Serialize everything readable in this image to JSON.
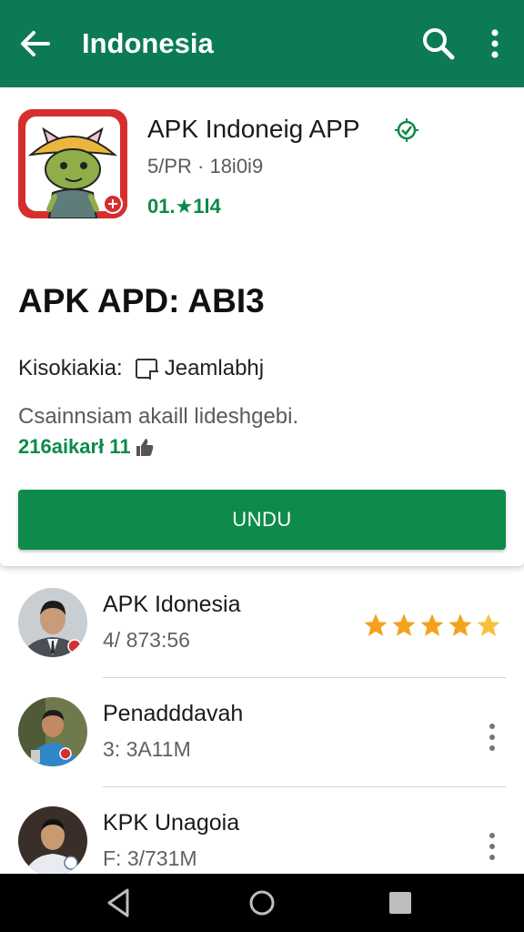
{
  "appbar": {
    "title": "Indonesia",
    "back_icon": "arrow-back-icon",
    "search_icon": "search-icon",
    "more_icon": "more-vert-icon",
    "color": "#0b7a55"
  },
  "app_card": {
    "name": "APK Indoneig APP",
    "developer": "5/PR · 18i0i9",
    "rating": "01.★1l4",
    "headline": "APK APD: ABI3",
    "meta_left": "Kisokiakia:",
    "meta_right": "Jeamlabhj",
    "description": "Csainnsiam akaill lideshgebi.",
    "downloads": "216aikarł 11",
    "install_label": "UNDU",
    "accent": "#0e8b4a"
  },
  "list": {
    "items": [
      {
        "title": "APK Idonesia",
        "subtitle": "4/ 873:56",
        "stars": 5
      },
      {
        "title": "Penadddavah",
        "subtitle": "3: 3A11M"
      },
      {
        "title": "KPK Unagoia",
        "subtitle": "F: 3/731M"
      }
    ]
  },
  "navbar": {
    "back_icon": "nav-back-icon",
    "home_icon": "nav-home-icon",
    "recent_icon": "nav-recents-icon"
  }
}
